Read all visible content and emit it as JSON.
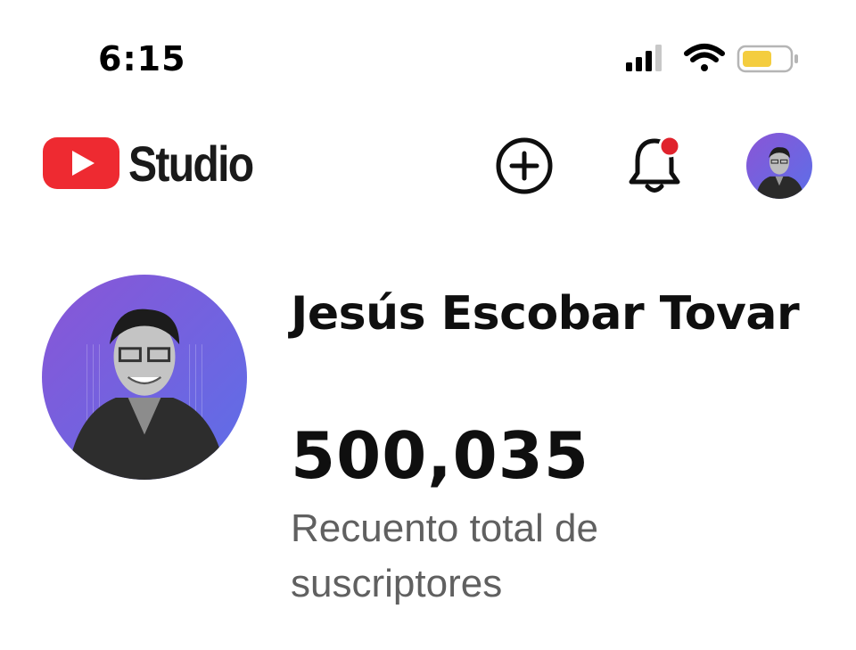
{
  "status_bar": {
    "time": "6:15",
    "icons": [
      "cellular-signal-icon",
      "wifi-icon",
      "battery-icon"
    ],
    "battery_color": "#f4cd3f"
  },
  "header": {
    "logo_text": "Studio",
    "brand_color": "#ee2a31",
    "actions": [
      "create-icon",
      "notifications-bell-icon",
      "account-avatar"
    ],
    "notification_dot_color": "#e0222c"
  },
  "channel": {
    "name": "Jesús Escobar Tovar",
    "subscriber_count": "500,035",
    "subscriber_caption": "Recuento total de suscriptores",
    "avatar_gradient": [
      "#8a55d6",
      "#5c6fe8"
    ]
  }
}
